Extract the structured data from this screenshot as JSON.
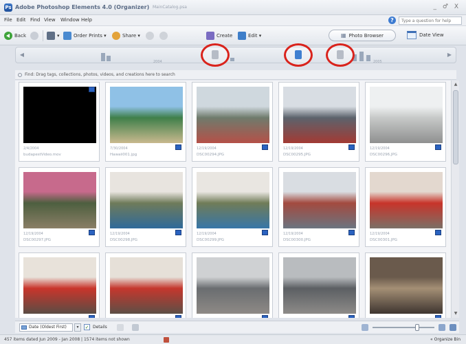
{
  "window": {
    "title": "Adobe Photoshop Elements 4.0 (Organizer)",
    "catalog": "MainCatalog.psa",
    "controls": "_ ♂ X"
  },
  "menu": [
    "File",
    "Edit",
    "Find",
    "View",
    "Window",
    "Help"
  ],
  "help_search": {
    "placeholder": "Type a question for help"
  },
  "toolbar": {
    "back": "Back",
    "order_prints": "Order Prints ▾",
    "share": "Share ▾",
    "create": "Create",
    "edit": "Edit ▾",
    "photo_browser": "Photo Browser",
    "date_view": "Date View"
  },
  "timeline": {
    "years": [
      "2004",
      "2005"
    ]
  },
  "find_bar": {
    "text": "Find: Drag tags, collections, photos, videos, and creations here to search"
  },
  "photos": [
    {
      "date": "2/4/2004",
      "name": "budapestVideo.mov",
      "colors": [
        "#000000",
        "#000000",
        "#000000"
      ],
      "badge_top": true
    },
    {
      "date": "7/30/2004",
      "name": "Hawaii001.jpg",
      "colors": [
        "#8fc1e6",
        "#3f7f4a",
        "#c9b98e"
      ],
      "badge_top": false
    },
    {
      "date": "12/19/2004",
      "name": "DSC00294.JPG",
      "colors": [
        "#cfd8de",
        "#6f7b6c",
        "#b55048"
      ],
      "badge_top": false
    },
    {
      "date": "12/19/2004",
      "name": "DSC00295.JPG",
      "colors": [
        "#d8dde3",
        "#5c636c",
        "#a23a34"
      ],
      "badge_top": false
    },
    {
      "date": "12/19/2004",
      "name": "DSC00296.JPG",
      "colors": [
        "#eef0f1",
        "#c7c9c8",
        "#8f9090"
      ],
      "badge_top": false
    },
    {
      "date": "12/19/2004",
      "name": "DSC00297.JPG",
      "colors": [
        "#c76a8c",
        "#4d5f3f",
        "#8a7e66"
      ],
      "badge_top": false
    },
    {
      "date": "12/19/2004",
      "name": "DSC00298.JPG",
      "colors": [
        "#e8e4df",
        "#6f7b5a",
        "#2f6a9a"
      ],
      "badge_top": false
    },
    {
      "date": "12/19/2004",
      "name": "DSC00299.JPG",
      "colors": [
        "#e9e6e1",
        "#707c58",
        "#3776a8"
      ],
      "badge_top": false
    },
    {
      "date": "12/19/2004",
      "name": "DSC00300.JPG",
      "colors": [
        "#d9dde2",
        "#a34a3f",
        "#6b7480"
      ],
      "badge_top": false
    },
    {
      "date": "12/19/2004",
      "name": "DSC00301.JPG",
      "colors": [
        "#e3d8cf",
        "#c8342a",
        "#7b6f66"
      ],
      "badge_top": false
    },
    {
      "date": "",
      "name": "",
      "colors": [
        "#e8e2da",
        "#c9352b",
        "#5a4c44"
      ],
      "badge_top": false
    },
    {
      "date": "",
      "name": "",
      "colors": [
        "#e6e0d8",
        "#c5372d",
        "#5d4f46"
      ],
      "badge_top": false
    },
    {
      "date": "",
      "name": "",
      "colors": [
        "#cfd1d3",
        "#6a6d70",
        "#8e8a86"
      ],
      "badge_top": false
    },
    {
      "date": "",
      "name": "",
      "colors": [
        "#b9bcbf",
        "#5c5f63",
        "#8d8b88"
      ],
      "badge_top": false
    },
    {
      "date": "",
      "name": "",
      "colors": [
        "#6a5a4c",
        "#a48f75",
        "#3e3530"
      ],
      "badge_top": false
    }
  ],
  "bottom_bar": {
    "sort": "Date (Oldest First)",
    "details_label": "Details",
    "details_checked": "✓"
  },
  "status": {
    "text": "457 items dated Jun 2009 - Jan 2008 | 1574 items not shown",
    "organize_bin": "« Organize Bin"
  },
  "colors": {
    "annotation_red": "#d9231c",
    "badge_blue": "#2a62c0"
  }
}
